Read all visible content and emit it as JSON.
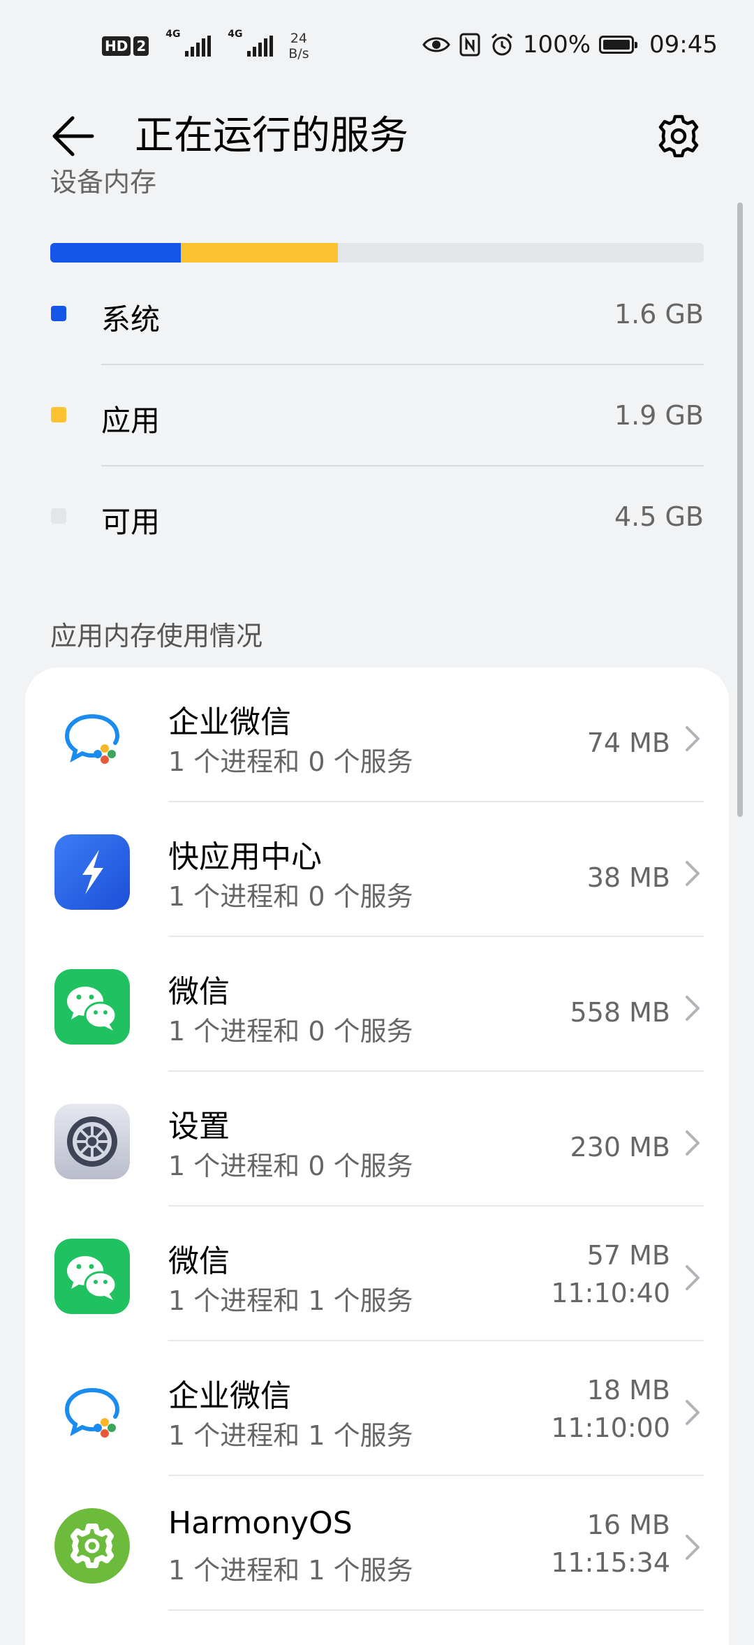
{
  "status_bar": {
    "hd_badge": "HD",
    "sim_badge": "2",
    "net1": "4G",
    "net2": "4G",
    "speed_value": "24",
    "speed_unit": "B/s",
    "battery": "100%",
    "time": "09:45"
  },
  "header": {
    "title": "正在运行的服务",
    "back_icon": "arrow-left-icon",
    "settings_icon": "gear-icon"
  },
  "memory": {
    "section_label": "设备内存",
    "legend": [
      {
        "name": "系统",
        "value": "1.6 GB",
        "color": "#1457e8"
      },
      {
        "name": "应用",
        "value": "1.9 GB",
        "color": "#fdc22f"
      },
      {
        "name": "可用",
        "value": "4.5 GB",
        "color": "#e3e5e8"
      }
    ],
    "bar_fractions": {
      "system": 0.2,
      "apps": 0.24,
      "free": 0.56
    }
  },
  "apps_section": {
    "title": "应用内存使用情况",
    "items": [
      {
        "name": "企业微信",
        "detail": "1 个进程和 0 个服务",
        "size": "74 MB",
        "time": "",
        "icon": "wecom-icon"
      },
      {
        "name": "快应用中心",
        "detail": "1 个进程和 0 个服务",
        "size": "38 MB",
        "time": "",
        "icon": "quick-app-icon"
      },
      {
        "name": "微信",
        "detail": "1 个进程和 0 个服务",
        "size": "558 MB",
        "time": "",
        "icon": "wechat-icon"
      },
      {
        "name": "设置",
        "detail": "1 个进程和 0 个服务",
        "size": "230 MB",
        "time": "",
        "icon": "settings-app-icon"
      },
      {
        "name": "微信",
        "detail": "1 个进程和 1 个服务",
        "size": "57 MB",
        "time": "11:10:40",
        "icon": "wechat-icon"
      },
      {
        "name": "企业微信",
        "detail": "1 个进程和 1 个服务",
        "size": "18 MB",
        "time": "11:10:00",
        "icon": "wecom-icon"
      },
      {
        "name": "HarmonyOS",
        "detail": "1 个进程和 1 个服务",
        "size": "16 MB",
        "time": "11:15:34",
        "icon": "harmonyos-icon"
      }
    ]
  }
}
